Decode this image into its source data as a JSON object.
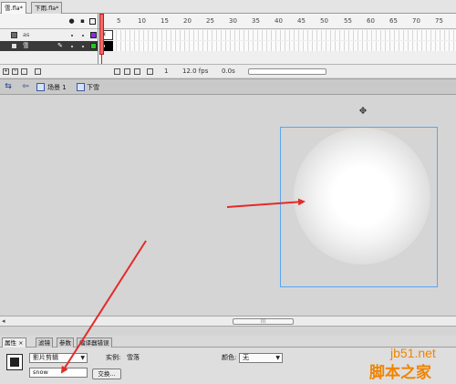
{
  "doc_tabs": [
    {
      "label": "雪.fla*",
      "active": true
    },
    {
      "label": "下雨.fla*",
      "active": false
    }
  ],
  "timeline": {
    "frame_numbers": [
      "5",
      "10",
      "15",
      "20",
      "25",
      "30",
      "35",
      "40",
      "45",
      "50",
      "55",
      "60",
      "65",
      "70",
      "75"
    ],
    "header_icons": [
      "eye-icon",
      "lock-icon",
      "outline-icon"
    ],
    "layers": [
      {
        "name": "as",
        "selected": false,
        "color": "#8a2be2"
      },
      {
        "name": "雪",
        "selected": true,
        "color": "#22c522"
      }
    ],
    "footer": {
      "current_frame": "1",
      "frame_rate": "12.0 fps",
      "elapsed": "0.0s"
    }
  },
  "editbar": {
    "scene_label": "场景 1",
    "symbol_label": "下雪"
  },
  "stage": {
    "frame_color": "#5aa6ef",
    "arrow_color": "#e52a2a"
  },
  "properties": {
    "tabs": [
      "属性",
      "滤镜",
      "参数",
      "编译器错误"
    ],
    "symbol_type": "影片剪辑",
    "instance_label": "实例:",
    "instance_value": "雪落",
    "color_label": "颜色:",
    "color_value": "无",
    "instance_name": "snow",
    "swap_button": "交换..."
  },
  "watermark": {
    "site": "jb51.net",
    "cn": "脚本之家"
  }
}
